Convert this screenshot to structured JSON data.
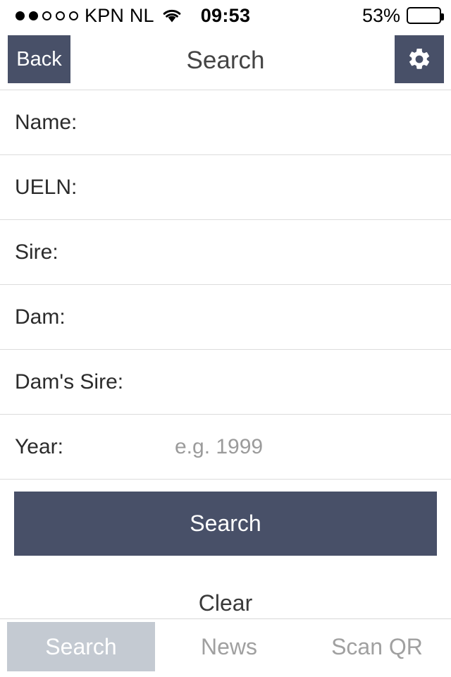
{
  "status_bar": {
    "signal_total": 5,
    "signal_filled": 2,
    "carrier": "KPN NL",
    "wifi_icon": "wifi-icon",
    "time": "09:53",
    "battery_percent": "53%",
    "battery_level": 53
  },
  "nav": {
    "back_label": "Back",
    "title": "Search",
    "settings_icon": "gear-icon"
  },
  "form": {
    "rows": [
      {
        "label": "Name:",
        "value": "",
        "placeholder": ""
      },
      {
        "label": "UELN:",
        "value": "",
        "placeholder": ""
      },
      {
        "label": "Sire:",
        "value": "",
        "placeholder": ""
      },
      {
        "label": "Dam:",
        "value": "",
        "placeholder": ""
      },
      {
        "label": "Dam's Sire:",
        "value": "",
        "placeholder": ""
      },
      {
        "label": "Year:",
        "value": "",
        "placeholder": "e.g. 1999"
      }
    ]
  },
  "actions": {
    "search_label": "Search",
    "clear_label": "Clear"
  },
  "tabbar": {
    "tabs": [
      {
        "label": "Search",
        "active": true
      },
      {
        "label": "News",
        "active": false
      },
      {
        "label": "Scan QR",
        "active": false
      }
    ]
  },
  "colors": {
    "accent": "#485068",
    "tab_active_bg": "#c4cad2",
    "divider": "#dcdcdc",
    "placeholder": "#9b9b9b",
    "title": "#444444"
  }
}
